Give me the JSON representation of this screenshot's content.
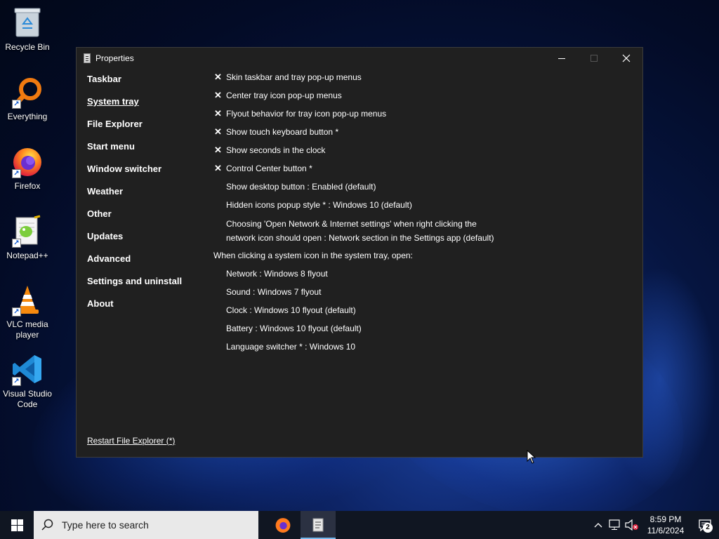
{
  "desktop": {
    "icons": [
      {
        "label": "Recycle Bin",
        "icon": "recycle-bin-icon"
      },
      {
        "label": "Everything",
        "icon": "everything-search-icon"
      },
      {
        "label": "Firefox",
        "icon": "firefox-icon"
      },
      {
        "label": "Notepad++",
        "icon": "notepad-plus-plus-icon"
      },
      {
        "label": "VLC media player",
        "icon": "vlc-cone-icon"
      },
      {
        "label": "Visual Studio Code",
        "icon": "vscode-icon"
      }
    ]
  },
  "window": {
    "title": "Properties",
    "nav": [
      {
        "label": "Taskbar",
        "active": false
      },
      {
        "label": "System tray",
        "active": true
      },
      {
        "label": "File Explorer",
        "active": false
      },
      {
        "label": "Start menu",
        "active": false
      },
      {
        "label": "Window switcher",
        "active": false
      },
      {
        "label": "Weather",
        "active": false
      },
      {
        "label": "Other",
        "active": false
      },
      {
        "label": "Updates",
        "active": false
      },
      {
        "label": "Advanced",
        "active": false
      },
      {
        "label": "Settings and uninstall",
        "active": false
      },
      {
        "label": "About",
        "active": false
      }
    ],
    "options": [
      {
        "label": "Skin taskbar and tray pop-up menus",
        "checked": true
      },
      {
        "label": "Center tray icon pop-up menus",
        "checked": true
      },
      {
        "label": "Flyout behavior for tray icon pop-up menus",
        "checked": true
      },
      {
        "label": "Show touch keyboard button *",
        "checked": true
      },
      {
        "label": "Show seconds in the clock",
        "checked": true
      },
      {
        "label": "Control Center button *",
        "checked": true
      },
      {
        "label": "Show desktop button : Enabled (default)",
        "checked": false
      },
      {
        "label": "Hidden icons popup style * : Windows 10 (default)",
        "checked": false
      },
      {
        "label": "Choosing 'Open Network & Internet settings' when right clicking the",
        "label2": "network icon should open : Network section in the Settings app (default)",
        "checked": false
      }
    ],
    "section_heading": "When clicking a system icon in the system tray, open:",
    "sub_options": [
      "Network : Windows 8 flyout",
      "Sound : Windows 7 flyout",
      "Clock : Windows 10 flyout (default)",
      "Battery : Windows 10 flyout (default)",
      "Language switcher * : Windows 10"
    ],
    "restart_link": "Restart File Explorer (*)",
    "check_glyph": "✕"
  },
  "taskbar": {
    "search_placeholder": "Type here to search",
    "apps": [
      {
        "icon": "firefox-icon",
        "active": false
      },
      {
        "icon": "properties-app-icon",
        "active": true
      }
    ],
    "clock_time": "8:59 PM",
    "clock_date": "11/6/2024",
    "notification_count": "2"
  }
}
